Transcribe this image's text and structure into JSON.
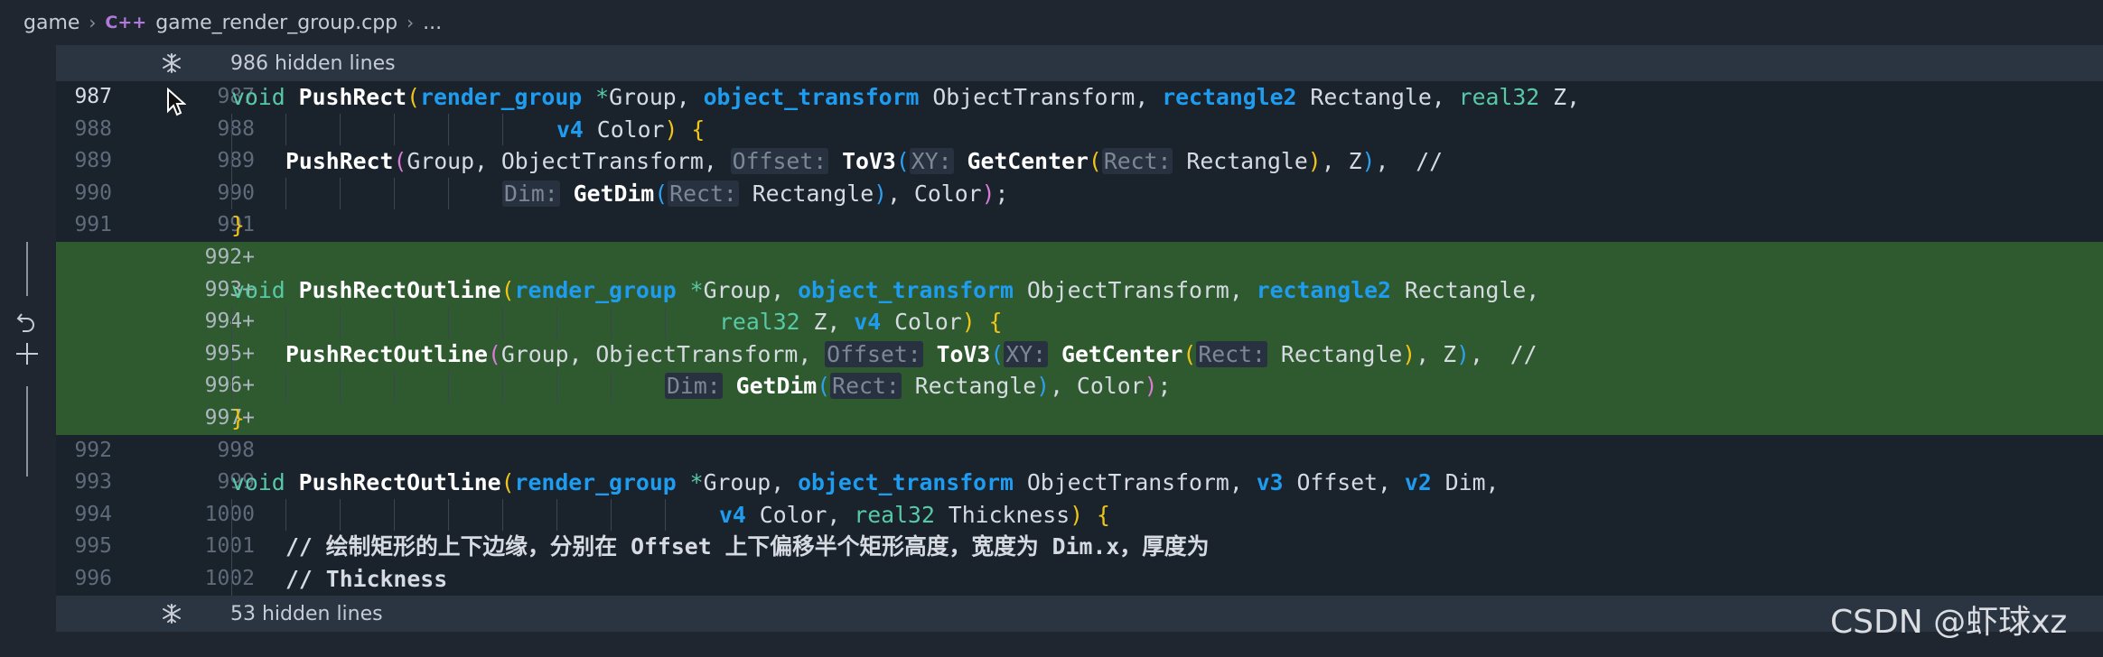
{
  "breadcrumb": {
    "folder": "game",
    "lang_badge": "C++",
    "file": "game_render_group.cpp",
    "more": "..."
  },
  "hidden_top": {
    "label": "986 hidden lines"
  },
  "hidden_bottom": {
    "label": "53 hidden lines"
  },
  "lines": [
    {
      "old": "987",
      "new": "987",
      "current": true,
      "added": false,
      "tokens": [
        {
          "t": "void",
          "c": "kw"
        },
        {
          "t": " "
        },
        {
          "t": "PushRect",
          "c": "fn"
        },
        {
          "t": "(",
          "c": "br1"
        },
        {
          "t": "render_group",
          "c": "ty"
        },
        {
          "t": " "
        },
        {
          "t": "*",
          "c": "ptr"
        },
        {
          "t": "Group, "
        },
        {
          "t": "object_transform",
          "c": "ty"
        },
        {
          "t": " ObjectTransform, "
        },
        {
          "t": "rectangle2",
          "c": "ty"
        },
        {
          "t": " Rectangle, "
        },
        {
          "t": "real32",
          "c": "kw"
        },
        {
          "t": " Z,"
        }
      ]
    },
    {
      "old": "988",
      "new": "988",
      "added": false,
      "indent": 6,
      "tokens": [
        {
          "t": "v4",
          "c": "ty"
        },
        {
          "t": " Color"
        },
        {
          "t": ")",
          "c": "br1"
        },
        {
          "t": " "
        },
        {
          "t": "{",
          "c": "br1"
        }
      ]
    },
    {
      "old": "989",
      "new": "989",
      "added": false,
      "indent": 1,
      "tokens": [
        {
          "t": "PushRect",
          "c": "fn"
        },
        {
          "t": "(",
          "c": "br2"
        },
        {
          "t": "Group, ObjectTransform, "
        },
        {
          "t": "Offset:",
          "c": "hint"
        },
        {
          "t": " "
        },
        {
          "t": "ToV3",
          "c": "fn"
        },
        {
          "t": "(",
          "c": "br3"
        },
        {
          "t": "XY:",
          "c": "hint"
        },
        {
          "t": " "
        },
        {
          "t": "GetCenter",
          "c": "fn"
        },
        {
          "t": "(",
          "c": "br1"
        },
        {
          "t": "Rect:",
          "c": "hint"
        },
        {
          "t": " Rectangle"
        },
        {
          "t": ")",
          "c": "br1"
        },
        {
          "t": ", Z"
        },
        {
          "t": ")",
          "c": "br3"
        },
        {
          "t": ",  //"
        }
      ]
    },
    {
      "old": "990",
      "new": "990",
      "added": false,
      "indent": 5,
      "tokens": [
        {
          "t": "Dim:",
          "c": "hint"
        },
        {
          "t": " "
        },
        {
          "t": "GetDim",
          "c": "fn"
        },
        {
          "t": "(",
          "c": "br3"
        },
        {
          "t": "Rect:",
          "c": "hint"
        },
        {
          "t": " Rectangle"
        },
        {
          "t": ")",
          "c": "br3"
        },
        {
          "t": ", Color"
        },
        {
          "t": ")",
          "c": "br2"
        },
        {
          "t": ";"
        }
      ]
    },
    {
      "old": "991",
      "new": "991",
      "added": false,
      "tokens": [
        {
          "t": "}",
          "c": "br1"
        }
      ]
    },
    {
      "old": "",
      "new": "992+",
      "added": true,
      "tokens": []
    },
    {
      "old": "",
      "new": "993+",
      "added": true,
      "tokens": [
        {
          "t": "void",
          "c": "kw"
        },
        {
          "t": " "
        },
        {
          "t": "PushRectOutline",
          "c": "fn"
        },
        {
          "t": "(",
          "c": "br1"
        },
        {
          "t": "render_group",
          "c": "ty"
        },
        {
          "t": " "
        },
        {
          "t": "*",
          "c": "ptr"
        },
        {
          "t": "Group, "
        },
        {
          "t": "object_transform",
          "c": "ty"
        },
        {
          "t": " ObjectTransform, "
        },
        {
          "t": "rectangle2",
          "c": "ty"
        },
        {
          "t": " Rectangle,"
        }
      ]
    },
    {
      "old": "",
      "new": "994+",
      "added": true,
      "indent": 9,
      "tokens": [
        {
          "t": "real32",
          "c": "kw"
        },
        {
          "t": " Z, "
        },
        {
          "t": "v4",
          "c": "ty"
        },
        {
          "t": " Color"
        },
        {
          "t": ")",
          "c": "br1"
        },
        {
          "t": " "
        },
        {
          "t": "{",
          "c": "br1"
        }
      ]
    },
    {
      "old": "",
      "new": "995+",
      "added": true,
      "indent": 1,
      "tokens": [
        {
          "t": "PushRectOutline",
          "c": "fn"
        },
        {
          "t": "(",
          "c": "br2"
        },
        {
          "t": "Group, ObjectTransform, "
        },
        {
          "t": "Offset:",
          "c": "hint"
        },
        {
          "t": " "
        },
        {
          "t": "ToV3",
          "c": "fn"
        },
        {
          "t": "(",
          "c": "br3"
        },
        {
          "t": "XY:",
          "c": "hint"
        },
        {
          "t": " "
        },
        {
          "t": "GetCenter",
          "c": "fn"
        },
        {
          "t": "(",
          "c": "br1"
        },
        {
          "t": "Rect:",
          "c": "hint"
        },
        {
          "t": " Rectangle"
        },
        {
          "t": ")",
          "c": "br1"
        },
        {
          "t": ", Z"
        },
        {
          "t": ")",
          "c": "br3"
        },
        {
          "t": ",  //"
        }
      ]
    },
    {
      "old": "",
      "new": "996+",
      "added": true,
      "indent": 8,
      "tokens": [
        {
          "t": "Dim:",
          "c": "hint"
        },
        {
          "t": " "
        },
        {
          "t": "GetDim",
          "c": "fn"
        },
        {
          "t": "(",
          "c": "br3"
        },
        {
          "t": "Rect:",
          "c": "hint"
        },
        {
          "t": " Rectangle"
        },
        {
          "t": ")",
          "c": "br3"
        },
        {
          "t": ", Color"
        },
        {
          "t": ")",
          "c": "br2"
        },
        {
          "t": ";"
        }
      ]
    },
    {
      "old": "",
      "new": "997+",
      "added": true,
      "tokens": [
        {
          "t": "}",
          "c": "br1"
        }
      ]
    },
    {
      "old": "992",
      "new": "998",
      "added": false,
      "tokens": []
    },
    {
      "old": "993",
      "new": "999",
      "added": false,
      "tokens": [
        {
          "t": "void",
          "c": "kw"
        },
        {
          "t": " "
        },
        {
          "t": "PushRectOutline",
          "c": "fn"
        },
        {
          "t": "(",
          "c": "br1"
        },
        {
          "t": "render_group",
          "c": "ty"
        },
        {
          "t": " "
        },
        {
          "t": "*",
          "c": "ptr"
        },
        {
          "t": "Group, "
        },
        {
          "t": "object_transform",
          "c": "ty"
        },
        {
          "t": " ObjectTransform, "
        },
        {
          "t": "v3",
          "c": "ty"
        },
        {
          "t": " Offset, "
        },
        {
          "t": "v2",
          "c": "ty"
        },
        {
          "t": " Dim,"
        }
      ]
    },
    {
      "old": "994",
      "new": "1000",
      "added": false,
      "indent": 9,
      "tokens": [
        {
          "t": "v4",
          "c": "ty"
        },
        {
          "t": " Color, "
        },
        {
          "t": "real32",
          "c": "kw"
        },
        {
          "t": " Thickness"
        },
        {
          "t": ")",
          "c": "br1"
        },
        {
          "t": " "
        },
        {
          "t": "{",
          "c": "br1"
        }
      ]
    },
    {
      "old": "995",
      "new": "1001",
      "added": false,
      "indent": 1,
      "tokens": [
        {
          "t": "// 绘制矩形的上下边缘，分别在 Offset 上下偏移半个矩形高度，宽度为 Dim.x，厚度为",
          "c": "cmt"
        }
      ]
    },
    {
      "old": "996",
      "new": "1002",
      "added": false,
      "indent": 1,
      "tokens": [
        {
          "t": "// Thickness",
          "c": "cmt"
        }
      ]
    }
  ],
  "watermark": "CSDN @虾球xz",
  "colors": {
    "added_bg": "#2f5a2f",
    "keyword": "#57c9a6",
    "type": "#1e9cf0",
    "bracket_gold": "#f0c419",
    "bracket_pink": "#d77bd5"
  }
}
